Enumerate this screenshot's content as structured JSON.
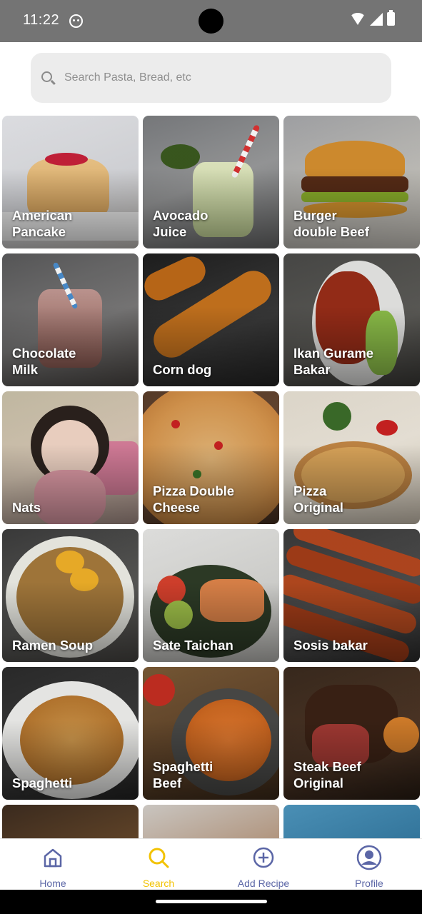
{
  "status_bar": {
    "time": "11:22"
  },
  "search": {
    "placeholder": "Search Pasta, Bread, etc",
    "value": ""
  },
  "recipes": [
    {
      "name": "American\nPancake"
    },
    {
      "name": "Avocado\nJuice"
    },
    {
      "name": "Burger\ndouble Beef"
    },
    {
      "name": "Chocolate\nMilk"
    },
    {
      "name": "Corn dog"
    },
    {
      "name": "Ikan Gurame\nBakar"
    },
    {
      "name": "Nats"
    },
    {
      "name": "Pizza Double\nCheese"
    },
    {
      "name": "Pizza\nOriginal"
    },
    {
      "name": "Ramen Soup"
    },
    {
      "name": "Sate Taichan"
    },
    {
      "name": "Sosis bakar"
    },
    {
      "name": "Spaghetti"
    },
    {
      "name": "Spaghetti\nBeef"
    },
    {
      "name": "Steak Beef\nOriginal"
    }
  ],
  "nav": {
    "home": "Home",
    "search": "Search",
    "add": "Add Recipe",
    "profile": "Profile",
    "active": "Search",
    "active_color": "#f2c200",
    "inactive_color": "#5b66a6"
  }
}
